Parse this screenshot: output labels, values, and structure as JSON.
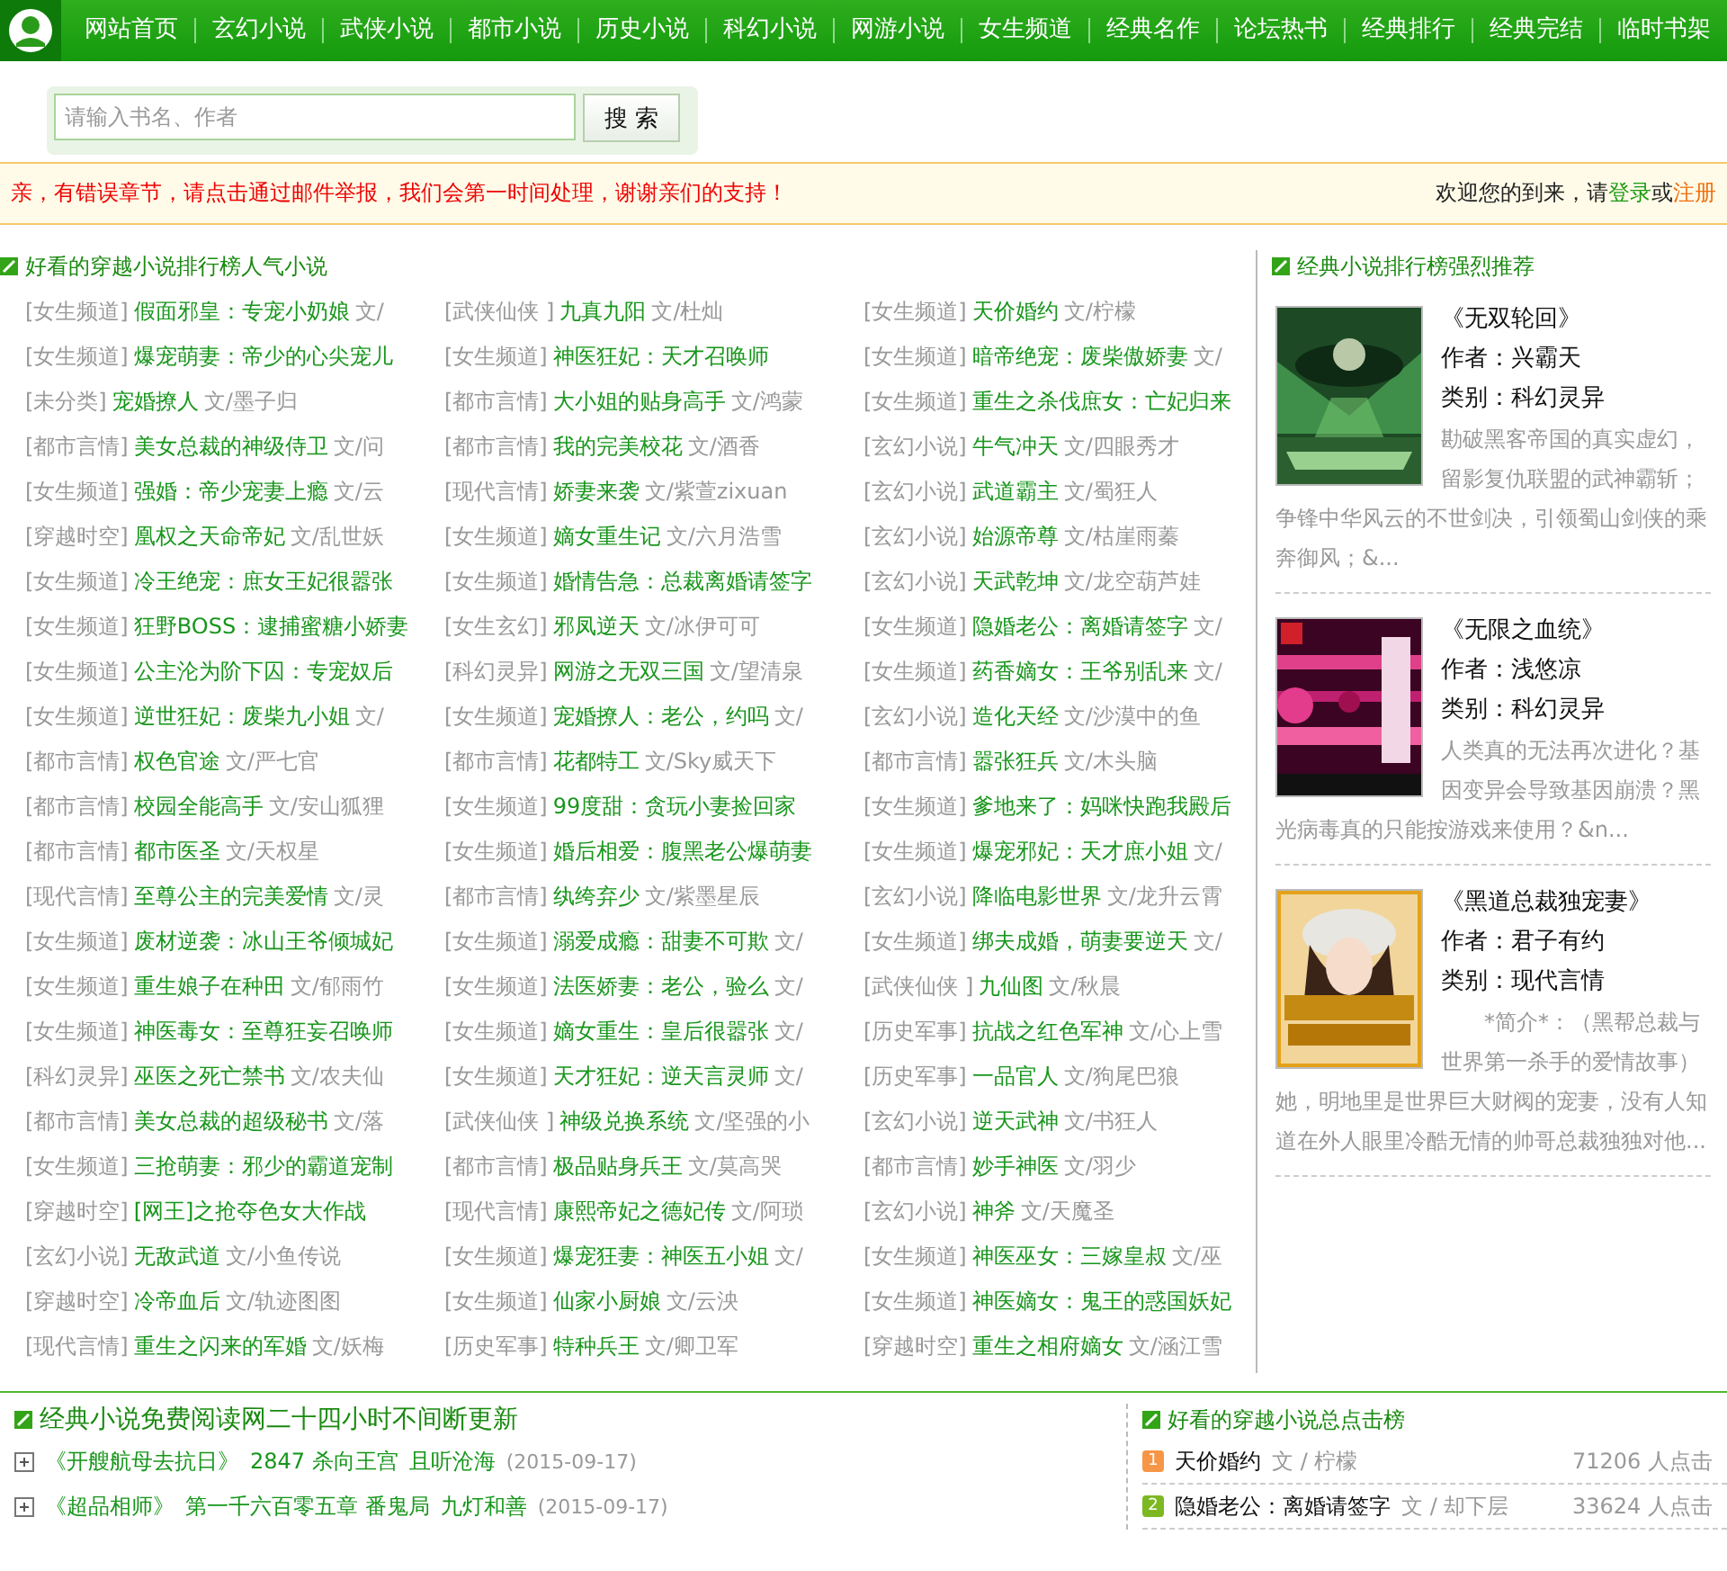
{
  "nav": {
    "items": [
      "网站首页",
      "玄幻小说",
      "武侠小说",
      "都市小说",
      "历史小说",
      "科幻小说",
      "网游小说",
      "女生频道",
      "经典名作",
      "论坛热书",
      "经典排行",
      "经典完结",
      "临时书架"
    ]
  },
  "search": {
    "placeholder": "请输入书名、作者",
    "button": "搜 索"
  },
  "notice": {
    "message": "亲，有错误章节，请点击通过邮件举报，我们会第一时间处理，谢谢亲们的支持！",
    "welcome": "欢迎您的到来，请",
    "login": "登录",
    "or": "或",
    "register": "注册"
  },
  "ranking": {
    "title": "好看的穿越小说排行榜人气小说",
    "items": [
      {
        "category": "[女生频道]",
        "title": "假面邪皇：专宠小奶娘",
        "author": "文/"
      },
      {
        "category": "[武侠仙侠 ]",
        "title": "九真九阳",
        "author": "文/杜灿"
      },
      {
        "category": "[女生频道]",
        "title": "天价婚约",
        "author": "文/柠檬"
      },
      {
        "category": "[女生频道]",
        "title": "爆宠萌妻：帝少的心尖宠儿"
      },
      {
        "category": "[女生频道]",
        "title": "神医狂妃：天才召唤师"
      },
      {
        "category": "[女生频道]",
        "title": "暗帝绝宠：废柴傲娇妻",
        "author": "文/"
      },
      {
        "category": "[未分类]",
        "title": "宠婚撩人",
        "author": "文/墨子归"
      },
      {
        "category": "[都市言情]",
        "title": "大小姐的贴身高手",
        "author": "文/鸿蒙"
      },
      {
        "category": "[女生频道]",
        "title": "重生之杀伐庶女：亡妃归来"
      },
      {
        "category": "[都市言情]",
        "title": "美女总裁的神级侍卫",
        "author": "文/问"
      },
      {
        "category": "[都市言情]",
        "title": "我的完美校花",
        "author": "文/酒香"
      },
      {
        "category": "[玄幻小说]",
        "title": "牛气冲天",
        "author": "文/四眼秀才"
      },
      {
        "category": "[女生频道]",
        "title": "强婚：帝少宠妻上瘾",
        "author": "文/云"
      },
      {
        "category": "[现代言情]",
        "title": "娇妻来袭",
        "author": "文/紫萱zixuan"
      },
      {
        "category": "[玄幻小说]",
        "title": "武道霸主",
        "author": "文/蜀狂人"
      },
      {
        "category": "[穿越时空]",
        "title": "凰权之天命帝妃",
        "author": "文/乱世妖"
      },
      {
        "category": "[女生频道]",
        "title": "嫡女重生记",
        "author": "文/六月浩雪"
      },
      {
        "category": "[玄幻小说]",
        "title": "始源帝尊",
        "author": "文/枯崖雨蓁"
      },
      {
        "category": "[女生频道]",
        "title": "冷王绝宠：庶女王妃很嚣张"
      },
      {
        "category": "[女生频道]",
        "title": "婚情告急：总裁离婚请签字"
      },
      {
        "category": "[玄幻小说]",
        "title": "天武乾坤",
        "author": "文/龙空葫芦娃"
      },
      {
        "category": "[女生频道]",
        "title": "狂野BOSS：逮捕蜜糖小娇妻"
      },
      {
        "category": "[女生玄幻]",
        "title": "邪凤逆天",
        "author": "文/冰伊可可"
      },
      {
        "category": "[女生频道]",
        "title": "隐婚老公：离婚请签字",
        "author": "文/"
      },
      {
        "category": "[女生频道]",
        "title": "公主沦为阶下囚：专宠奴后"
      },
      {
        "category": "[科幻灵异]",
        "title": "网游之无双三国",
        "author": "文/望清泉"
      },
      {
        "category": "[女生频道]",
        "title": "药香嫡女：王爷别乱来",
        "author": "文/"
      },
      {
        "category": "[女生频道]",
        "title": "逆世狂妃：废柴九小姐",
        "author": "文/"
      },
      {
        "category": "[女生频道]",
        "title": "宠婚撩人：老公，约吗",
        "author": "文/"
      },
      {
        "category": "[玄幻小说]",
        "title": "造化天经",
        "author": "文/沙漠中的鱼"
      },
      {
        "category": "[都市言情]",
        "title": "权色官途",
        "author": "文/严七官"
      },
      {
        "category": "[都市言情]",
        "title": "花都特工",
        "author": "文/Sky威天下"
      },
      {
        "category": "[都市言情]",
        "title": "嚣张狂兵",
        "author": "文/木头脑"
      },
      {
        "category": "[都市言情]",
        "title": "校园全能高手",
        "author": "文/安山狐狸"
      },
      {
        "category": "[女生频道]",
        "title": "99度甜：贪玩小妻捡回家"
      },
      {
        "category": "[女生频道]",
        "title": "爹地来了：妈咪快跑我殿后"
      },
      {
        "category": "[都市言情]",
        "title": "都市医圣",
        "author": "文/天权星"
      },
      {
        "category": "[女生频道]",
        "title": "婚后相爱：腹黑老公爆萌妻"
      },
      {
        "category": "[女生频道]",
        "title": "爆宠邪妃：天才庶小姐",
        "author": "文/"
      },
      {
        "category": "[现代言情]",
        "title": "至尊公主的完美爱情",
        "author": "文/灵"
      },
      {
        "category": "[都市言情]",
        "title": "纨绔弃少",
        "author": "文/紫墨星辰"
      },
      {
        "category": "[玄幻小说]",
        "title": "降临电影世界",
        "author": "文/龙升云霄"
      },
      {
        "category": "[女生频道]",
        "title": "废材逆袭：冰山王爷倾城妃"
      },
      {
        "category": "[女生频道]",
        "title": "溺爱成瘾：甜妻不可欺",
        "author": "文/"
      },
      {
        "category": "[女生频道]",
        "title": "绑夫成婚，萌妻要逆天",
        "author": "文/"
      },
      {
        "category": "[女生频道]",
        "title": "重生娘子在种田",
        "author": "文/郁雨竹"
      },
      {
        "category": "[女生频道]",
        "title": "法医娇妻：老公，验么",
        "author": "文/"
      },
      {
        "category": "[武侠仙侠 ]",
        "title": "九仙图",
        "author": "文/秋晨"
      },
      {
        "category": "[女生频道]",
        "title": "神医毒女：至尊狂妄召唤师"
      },
      {
        "category": "[女生频道]",
        "title": "嫡女重生：皇后很嚣张",
        "author": "文/"
      },
      {
        "category": "[历史军事]",
        "title": "抗战之红色军神",
        "author": "文/心上雪"
      },
      {
        "category": "[科幻灵异]",
        "title": "巫医之死亡禁书",
        "author": "文/农夫仙"
      },
      {
        "category": "[女生频道]",
        "title": "天才狂妃：逆天言灵师",
        "author": "文/"
      },
      {
        "category": "[历史军事]",
        "title": "一品官人",
        "author": "文/狗尾巴狼"
      },
      {
        "category": "[都市言情]",
        "title": "美女总裁的超级秘书",
        "author": "文/落"
      },
      {
        "category": "[武侠仙侠 ]",
        "title": "神级兑换系统",
        "author": "文/坚强的小"
      },
      {
        "category": "[玄幻小说]",
        "title": "逆天武神",
        "author": "文/书狂人"
      },
      {
        "category": "[女生频道]",
        "title": "三抢萌妻：邪少的霸道宠制"
      },
      {
        "category": "[都市言情]",
        "title": "极品贴身兵王",
        "author": "文/莫高哭"
      },
      {
        "category": "[都市言情]",
        "title": "妙手神医",
        "author": "文/羽少"
      },
      {
        "category": "[穿越时空]",
        "title": "[网王]之抢夺色女大作战"
      },
      {
        "category": "[现代言情]",
        "title": "康熙帝妃之德妃传",
        "author": "文/阿琐"
      },
      {
        "category": "[玄幻小说]",
        "title": "神斧",
        "author": "文/天魔圣"
      },
      {
        "category": "[玄幻小说]",
        "title": "无敌武道",
        "author": "文/小鱼传说"
      },
      {
        "category": "[女生频道]",
        "title": "爆宠狂妻：神医五小姐",
        "author": "文/"
      },
      {
        "category": "[女生频道]",
        "title": "神医巫女：三嫁皇叔",
        "author": "文/巫"
      },
      {
        "category": "[穿越时空]",
        "title": "冷帝血后",
        "author": "文/轨迹图图"
      },
      {
        "category": "[女生频道]",
        "title": "仙家小厨娘",
        "author": "文/云泱"
      },
      {
        "category": "[女生频道]",
        "title": "神医嫡女：鬼王的惑国妖妃"
      },
      {
        "category": "[现代言情]",
        "title": "重生之闪来的军婚",
        "author": "文/妖梅"
      },
      {
        "category": "[历史军事]",
        "title": "特种兵王",
        "author": "文/卿卫军"
      },
      {
        "category": "[穿越时空]",
        "title": "重生之相府嫡女",
        "author": "文/涵江雪"
      }
    ]
  },
  "recommend": {
    "title": "经典小说排行榜强烈推荐",
    "books": [
      {
        "title": "《无双轮回》",
        "author": "作者：兴霸天",
        "category": "类别：科幻灵异",
        "summary": "勘破黑客帝国的真实虚幻，留影复仇联盟的武神霸斩；争锋中华风云的不世剑决，引领蜀山剑侠的乘奔御风；&..."
      },
      {
        "title": "《无限之血统》",
        "author": "作者：浅悠凉",
        "category": "类别：科幻灵异",
        "summary": "人类真的无法再次进化？基因变异会导致基因崩溃？黑光病毒真的只能按游戏来使用？&n..."
      },
      {
        "title": "《黑道总裁独宠妻》",
        "author": "作者：君子有约",
        "category": "类别：现代言情",
        "summary": "　　*简介*：（黑帮总裁与世界第一杀手的爱情故事）她，明地里是世界巨大财阀的宠妻，没有人知道在外人眼里冷酷无情的帅哥总裁独独对他..."
      }
    ]
  },
  "updates": {
    "title": "经典小说免费阅读网二十四小时不间断更新",
    "items": [
      {
        "title": "《开艘航母去抗日》",
        "chapter": "2847 杀向王宫",
        "author": "且听沧海",
        "date": "(2015-09-17)"
      },
      {
        "title": "《超品相师》",
        "chapter": "第一千六百零五章 番鬼局",
        "author": "九灯和善",
        "date": "(2015-09-17)"
      }
    ]
  },
  "clicks": {
    "title": "好看的穿越小说总点击榜",
    "items": [
      {
        "rank": "1",
        "color": "#f79646",
        "title": "天价婚约",
        "author": "文 / 柠檬",
        "count": "71206 人点击"
      },
      {
        "rank": "2",
        "color": "#7db823",
        "title": "隐婚老公：离婚请签字",
        "author": "文 / 却下层",
        "count": "33624 人点击"
      }
    ]
  }
}
